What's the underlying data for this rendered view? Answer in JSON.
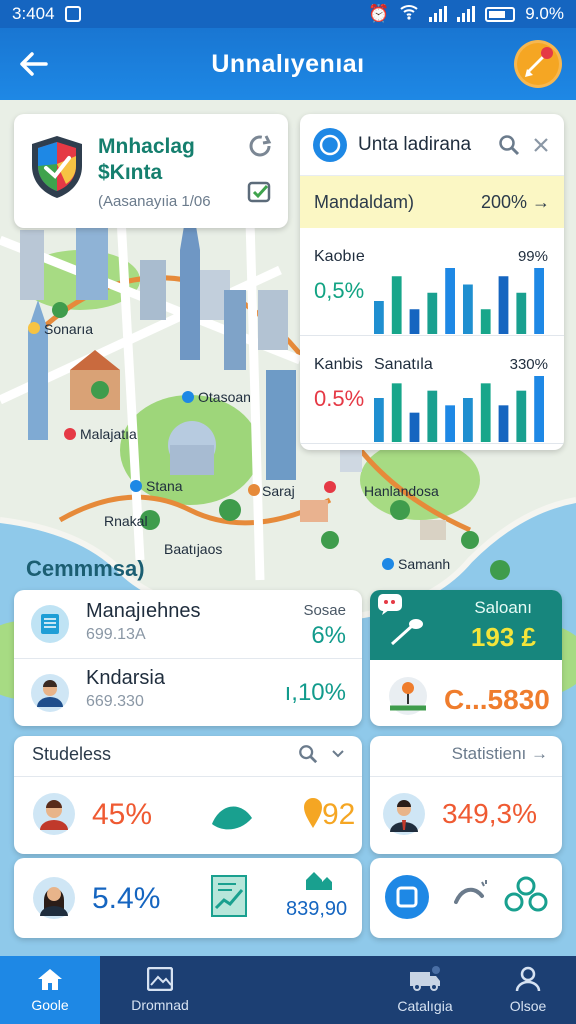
{
  "status_bar": {
    "time": "3:404",
    "battery": "9.0%"
  },
  "header": {
    "title": "Unnalıyenıaı"
  },
  "map_labels": [
    "Sonarıa",
    "Otasoan",
    "Malajatıa",
    "Stana",
    "Saraj",
    "Hanlandosa",
    "Rnakal",
    "Baatıjaos",
    "Samanh"
  ],
  "app_card": {
    "name_line1": "Mnhaclag",
    "name_line2": "$Kınta",
    "subtitle": "(Aasanayıia 1/06"
  },
  "panel": {
    "title": "Unta ladirana",
    "strip": {
      "label": "Mandaldam)",
      "value": "200% →"
    },
    "charts": [
      {
        "label": "Kaobıe",
        "value": "0,5%",
        "percent": "99%",
        "value_color": "#12a383"
      },
      {
        "label": "Kanbis",
        "mid_label": "Sanatıla",
        "value": "0.5%",
        "percent": "330%",
        "value_color": "#e53945"
      }
    ]
  },
  "chart_data": [
    {
      "type": "bar",
      "values": [
        4,
        7,
        3,
        5,
        8,
        6,
        3,
        7,
        5,
        8
      ]
    },
    {
      "type": "bar",
      "values": [
        6,
        8,
        4,
        7,
        5,
        6,
        8,
        5,
        7,
        9
      ]
    }
  ],
  "section_label": "Cemmmsa)",
  "list_card": [
    {
      "name": "Manajıehnes",
      "sub": "699.13A",
      "small": "Sosae",
      "value": "6%"
    },
    {
      "name": "Kndarsia",
      "sub": "669.330",
      "value": "ı,10%"
    }
  ],
  "teal_card": {
    "title": "Saloanı",
    "value": "193 £",
    "bottom_value": "C...5830"
  },
  "students": {
    "title": "Studeless",
    "row1_value": "45%",
    "row1_right": "92",
    "row2_value": "5.4%",
    "row2_right": "839,90"
  },
  "statistics": {
    "title": "Statistienı →",
    "value": "349,3%"
  },
  "bottom_nav": [
    {
      "label": "Goole"
    },
    {
      "label": "Dromnad"
    },
    {
      "label": "Catalıgia"
    },
    {
      "label": "Olsoe"
    }
  ]
}
